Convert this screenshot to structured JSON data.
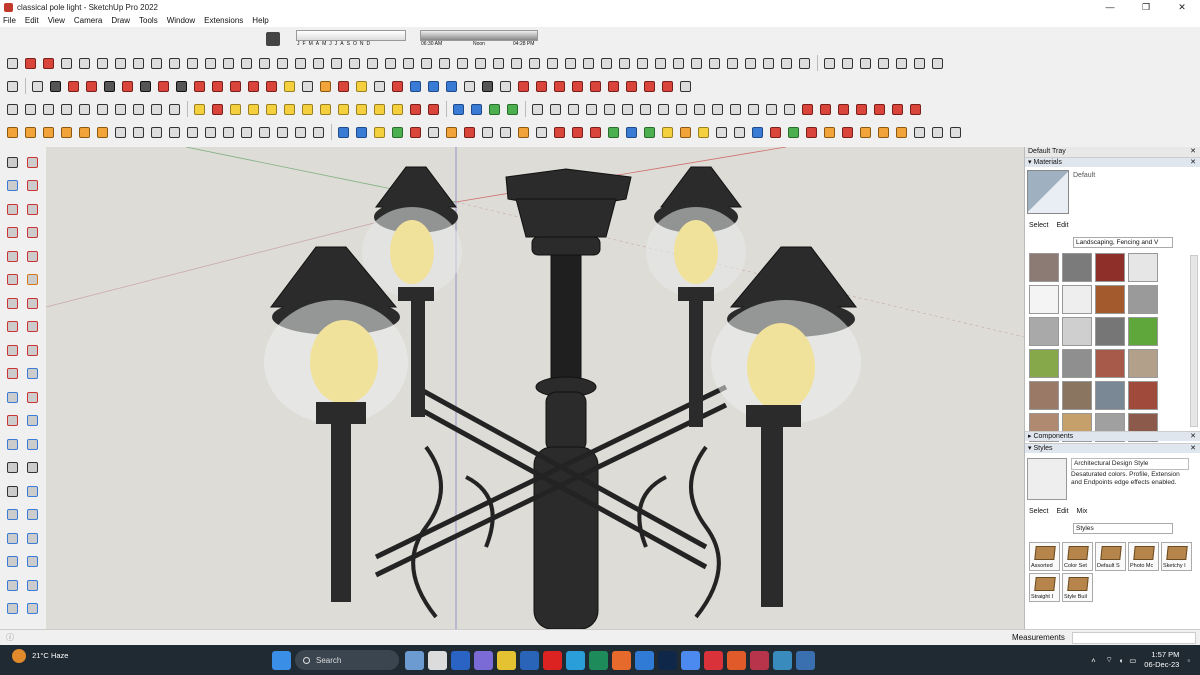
{
  "window": {
    "title": "classical pole light - SketchUp Pro 2022",
    "controls": [
      "—",
      "❐",
      "✕"
    ]
  },
  "menu": [
    "File",
    "Edit",
    "View",
    "Camera",
    "Draw",
    "Tools",
    "Window",
    "Extensions",
    "Help"
  ],
  "shadow": {
    "months": [
      "J",
      "F",
      "M",
      "A",
      "M",
      "J",
      "J",
      "A",
      "S",
      "O",
      "N",
      "D"
    ],
    "time_start": "06:30 AM",
    "time_mid": "Noon",
    "time_end": "04:28 PM"
  },
  "tray": {
    "title": "Default Tray",
    "materials": {
      "section": "Materials",
      "current": "Default",
      "tab_select": "Select",
      "tab_edit": "Edit",
      "collection": "Landscaping, Fencing and V"
    },
    "swatch_colors": [
      "#8c7a74",
      "#7b7b7b",
      "#8e2f2a",
      "#e6e6e6",
      "#f4f4f4",
      "#eeeeee",
      "#a35a2c",
      "#9a9a9a",
      "#a9a9a9",
      "#cfcfcf",
      "#767676",
      "#5fa73a",
      "#87a84a",
      "#8f8f8f",
      "#a85a4a",
      "#b3a08a",
      "#9a7a66",
      "#8a7560",
      "#7a8896",
      "#a04a3c",
      "#b08a70",
      "#c6a06a",
      "#a0a0a0",
      "#8c5a4a"
    ],
    "components": {
      "section": "Components"
    },
    "styles": {
      "section": "Styles",
      "name": "Architectural Design Style",
      "description": "Desaturated colors. Profile, Extension and Endpoints edge effects enabled.",
      "tab_select": "Select",
      "tab_edit": "Edit",
      "tab_mix": "Mix",
      "collection": "Styles",
      "items": [
        "Assorted",
        "Color Set",
        "Default S",
        "Photo Mc",
        "Sketchy I",
        "Straight I",
        "Style Buil"
      ]
    }
  },
  "status": {
    "measurements": "Measurements"
  },
  "taskbar": {
    "temp": "21°C",
    "weather": "Haze",
    "search": "Search",
    "time": "1:57 PM",
    "date": "06-Dec-23"
  }
}
